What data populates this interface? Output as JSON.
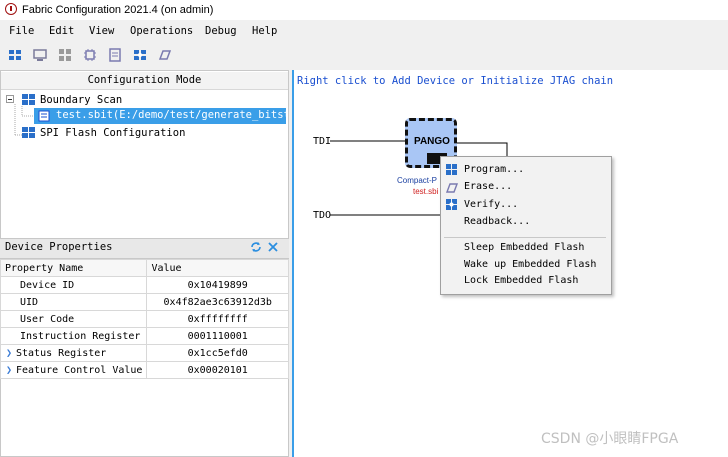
{
  "window": {
    "title": "Fabric Configuration 2021.4 (on admin)"
  },
  "menu": [
    "File",
    "Edit",
    "View",
    "Operations",
    "Debug",
    "Help"
  ],
  "toolbar": {
    "icons": [
      "chain-icon",
      "monitor-icon",
      "grid-icon",
      "chip-icon",
      "register-icon",
      "settings-icon",
      "erase-icon"
    ]
  },
  "config": {
    "header": "Configuration Mode",
    "tree": {
      "boundary_scan": "Boundary Scan",
      "sbit_item": "test.sbit(E:/demo/test/generate_bitst...",
      "spi_flash": "SPI Flash Configuration"
    }
  },
  "device_properties": {
    "title": "Device Properties",
    "columns": [
      "Property Name",
      "Value"
    ],
    "rows": [
      {
        "name": "Device ID",
        "value": "0x10419899",
        "expandable": false
      },
      {
        "name": "UID",
        "value": "0x4f82ae3c63912d3b",
        "expandable": false
      },
      {
        "name": "User Code",
        "value": "0xffffffff",
        "expandable": false
      },
      {
        "name": "Instruction Register",
        "value": "0001110001",
        "expandable": false
      },
      {
        "name": "Status Register",
        "value": "0x1cc5efd0",
        "expandable": true
      },
      {
        "name": "Feature Control Value",
        "value": "0x00020101",
        "expandable": true
      }
    ]
  },
  "canvas": {
    "hint": "Right click to Add Device or Initialize JTAG chain",
    "tdi": "TDI",
    "tdo": "TDO",
    "chip_label": "PANGO",
    "chip_model": "Compact-P",
    "chip_file": "test.sbi"
  },
  "context_menu": {
    "items": [
      "Program...",
      "Erase...",
      "Verify...",
      "Readback...",
      "Sleep Embedded Flash",
      "Wake up Embedded Flash",
      "Lock Embedded Flash"
    ]
  },
  "watermark": "CSDN @小眼睛FPGA",
  "colors": {
    "accent": "#3a9ee8",
    "chip": "#a9c6f5",
    "hint": "#1a4fd0",
    "file": "#d02020"
  }
}
